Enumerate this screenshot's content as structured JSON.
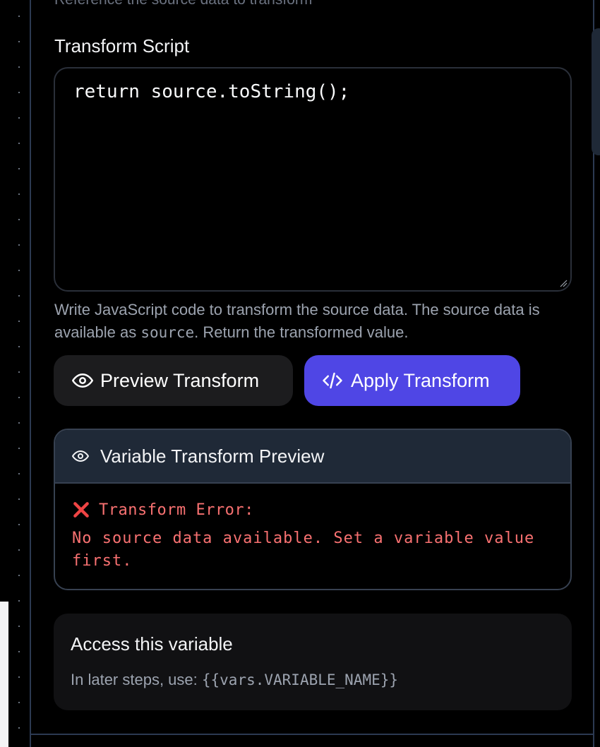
{
  "transform": {
    "cut_off_description": "Reference the source data to transform",
    "script_label": "Transform Script",
    "script_value": "return source.toString();",
    "help_prefix": "Write JavaScript code to transform the source data. The source data is available as ",
    "help_code": "source",
    "help_suffix": ". Return the transformed value."
  },
  "buttons": {
    "preview_label": "Preview Transform",
    "preview_icon": "eye-icon",
    "apply_label": "Apply Transform",
    "apply_icon": "code-icon"
  },
  "preview": {
    "title": "Variable Transform Preview",
    "title_icon": "eye-icon",
    "error_icon": "x-mark-icon",
    "error_title": "Transform Error:",
    "error_message": "No source data available. Set a variable value first."
  },
  "access": {
    "title": "Access this variable",
    "hint_prefix": "In later steps, use: ",
    "hint_code": "{{vars.VARIABLE_NAME}}"
  },
  "colors": {
    "accent": "#4f46e5",
    "error": "#f87171",
    "background": "#000000",
    "border": "#2c3a52"
  }
}
